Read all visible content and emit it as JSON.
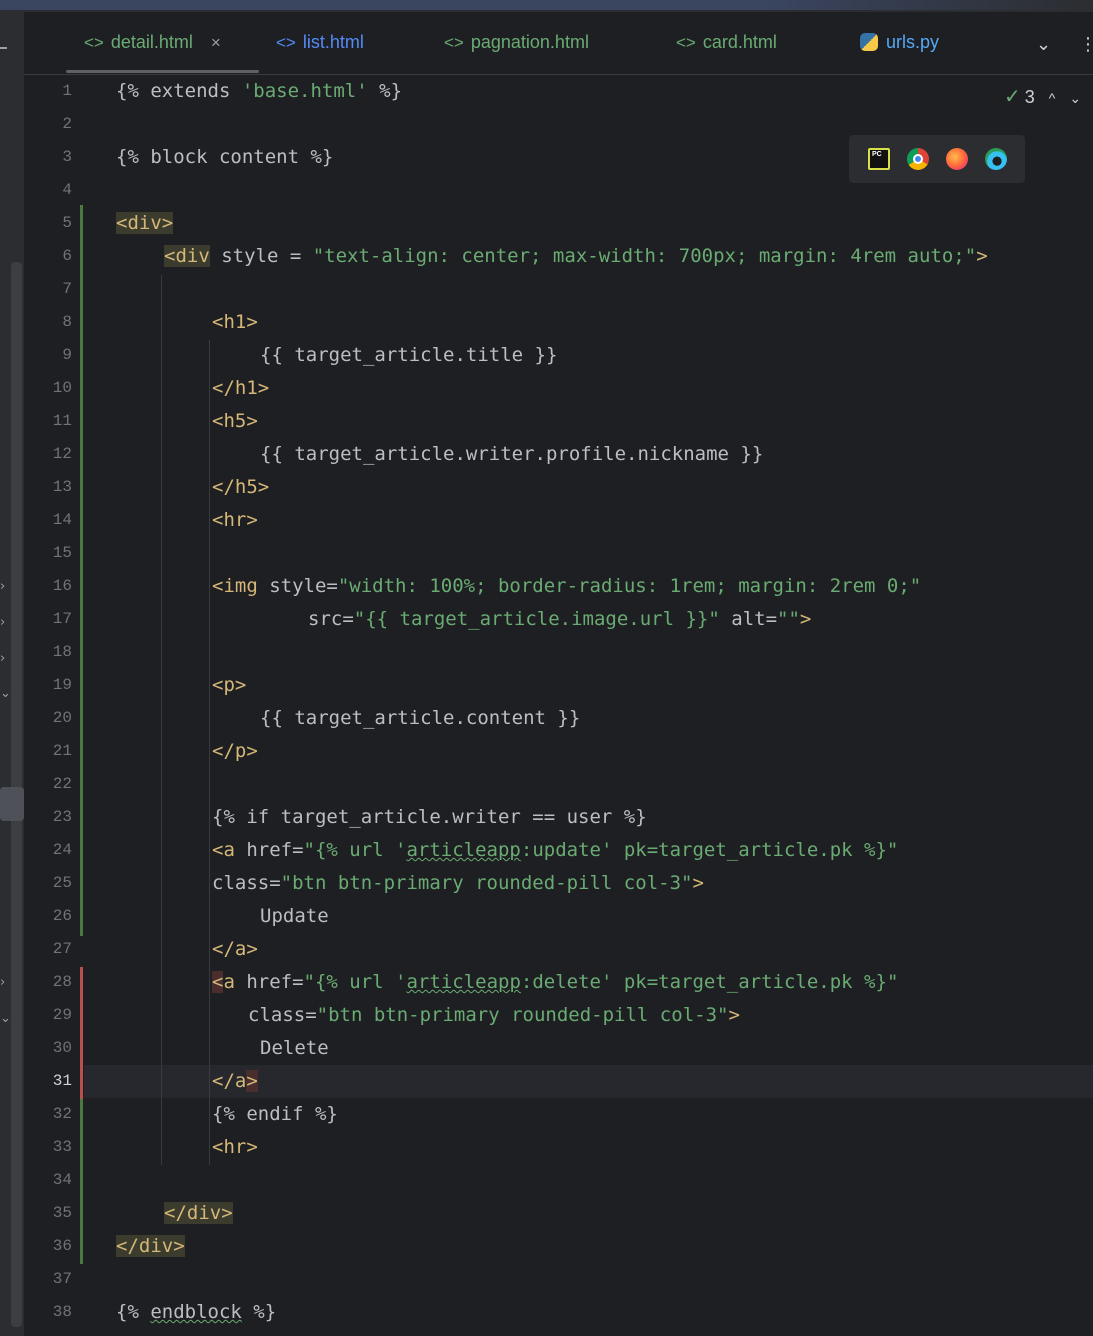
{
  "tabs": [
    {
      "icon": "<>",
      "label": "detail.html",
      "close": "×",
      "active": true
    },
    {
      "icon": "<>",
      "label": "list.html"
    },
    {
      "icon": "<>",
      "label": "pagnation.html"
    },
    {
      "icon": "<>",
      "label": "card.html"
    },
    {
      "icon": "python-icon",
      "label": "urls.py"
    }
  ],
  "tab_actions": {
    "dropdown": "⌄",
    "more": "⋮"
  },
  "inspections": {
    "count": "3",
    "up": "^",
    "down": "⌄"
  },
  "browsers": [
    "pycharm-icon",
    "chrome-icon",
    "firefox-icon",
    "edge-icon"
  ],
  "current_line": "31",
  "line_numbers": [
    "1",
    "2",
    "3",
    "4",
    "5",
    "6",
    "7",
    "8",
    "9",
    "10",
    "11",
    "12",
    "13",
    "14",
    "15",
    "16",
    "17",
    "18",
    "19",
    "20",
    "21",
    "22",
    "23",
    "24",
    "25",
    "26",
    "27",
    "28",
    "29",
    "30",
    "31",
    "32",
    "33",
    "34",
    "35",
    "36",
    "37",
    "38"
  ],
  "code": {
    "l1": {
      "a": "{% extends ",
      "b": "'base.html'",
      "c": " %}"
    },
    "l3": {
      "a": "{% block content %}"
    },
    "l5": {
      "a": "<div>"
    },
    "l6": {
      "a": "<div",
      "b": " style = ",
      "c": "\"text-align: center; max-width: 700px; margin: 4rem auto;\"",
      "d": ">"
    },
    "l8": {
      "a": "<h1>"
    },
    "l9": {
      "a": "{{ target_article.title }}"
    },
    "l10": {
      "a": "</h1>"
    },
    "l11": {
      "a": "<h5>"
    },
    "l12": {
      "a": "{{ target_article.writer.profile.nickname }}"
    },
    "l13": {
      "a": "</h5>"
    },
    "l14": {
      "a": "<hr>"
    },
    "l16": {
      "a": "<img",
      "b": " style=",
      "c": "\"width: 100%; border-radius: 1rem; margin: 2rem 0;\""
    },
    "l17": {
      "a": "src=",
      "b": "\"{{ target_article.image.url }}\"",
      "c": " alt=",
      "d": "\"\"",
      "e": ">"
    },
    "l19": {
      "a": "<p>"
    },
    "l20": {
      "a": "{{ target_article.content }}"
    },
    "l21": {
      "a": "</p>"
    },
    "l23": {
      "a": "{% if target_article.writer == user %}"
    },
    "l24": {
      "a": "<a",
      "b": " href=",
      "c": "\"{% url '",
      "d": "articleapp",
      "e": ":update' pk=target_article.pk %}\""
    },
    "l25": {
      "a": "class=",
      "b": "\"btn btn-primary rounded-pill col-3\"",
      "c": ">"
    },
    "l26": {
      "a": "Update"
    },
    "l27": {
      "a": "</a>"
    },
    "l28": {
      "a": "<",
      "b": "a",
      "c": " href=",
      "d": "\"{% url '",
      "e": "articleapp",
      "f": ":delete' pk=target_article.pk %}\""
    },
    "l29": {
      "a": "class=",
      "b": "\"btn btn-primary rounded-pill col-3\"",
      "c": ">"
    },
    "l30": {
      "a": "Delete"
    },
    "l31": {
      "a": "</a",
      "b": ">"
    },
    "l32": {
      "a": "{% endif %}"
    },
    "l33": {
      "a": "<hr>"
    },
    "l35": {
      "a": "</div>"
    },
    "l36": {
      "a": "</div>"
    },
    "l38": {
      "a": "{% ",
      "b": "endblock",
      "c": " %}"
    }
  }
}
